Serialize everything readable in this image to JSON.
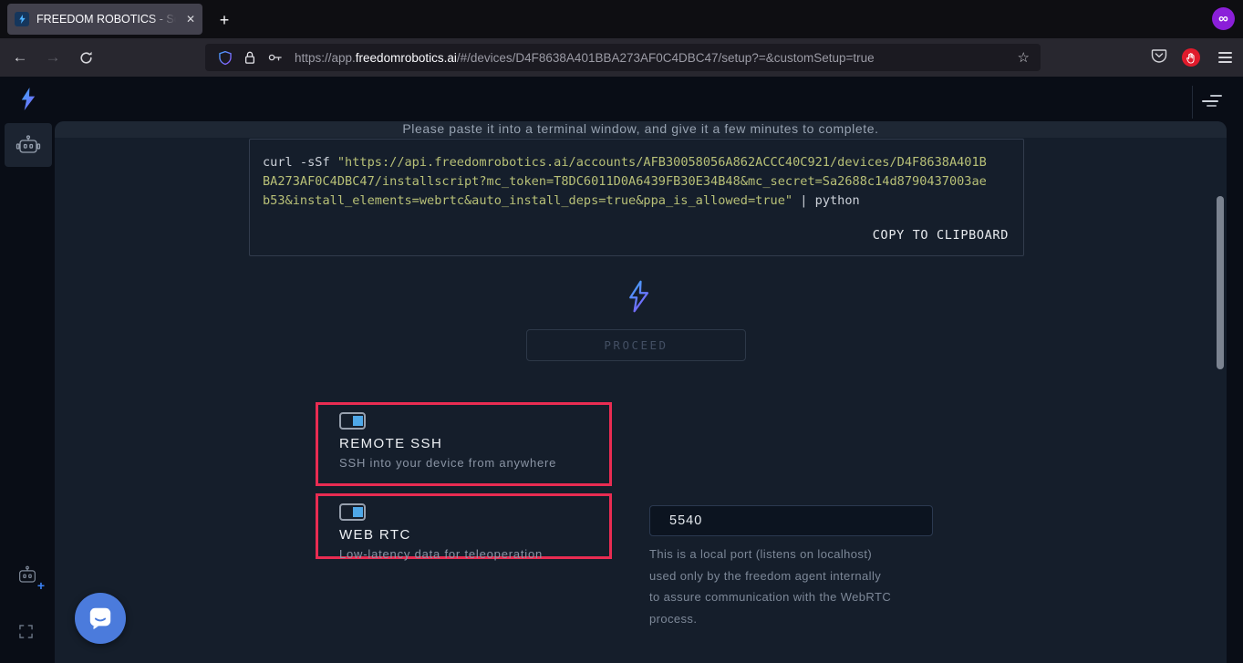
{
  "browser": {
    "tab": {
      "title": "FREEDOM ROBOTICS - Se",
      "close_glyph": "✕"
    },
    "new_tab_glyph": "+",
    "private_badge_glyph": "∞",
    "nav": {
      "back_glyph": "←",
      "forward_glyph": "→"
    },
    "url": {
      "prefix": "https://app.",
      "domain": "freedomrobotics.ai",
      "path": "/#/devices/D4F8638A401BBA273AF0C4DBC47/setup?=&customSetup=true"
    },
    "bookmark_star_glyph": "☆"
  },
  "sidebar": {
    "items": [
      "devices"
    ],
    "add_device_plus_glyph": "+"
  },
  "page": {
    "instruction_clipped": "Please paste it into a terminal window, and give it a few minutes to complete.",
    "code": {
      "lines": [
        [
          {
            "type": "plain",
            "text": "curl -sSf "
          },
          {
            "type": "string",
            "text": "\"https://api.freedomrobotics.ai/accounts/AFB30058056A862ACCC40C921/devices/D4F8638A401B"
          }
        ],
        [
          {
            "type": "string",
            "text": "BA273AF0C4DBC47/installscript?mc_token=T8DC6011D0A6439FB30E34B48&mc_secret=Sa2688c14d8790437003ae"
          }
        ],
        [
          {
            "type": "string",
            "text": "b53&install_elements=webrtc&auto_install_deps=true&ppa_is_allowed=true\""
          },
          {
            "type": "plain",
            "text": " | python"
          }
        ]
      ],
      "copy_label": "COPY TO CLIPBOARD"
    },
    "proceed_label": "PROCEED",
    "features": [
      {
        "title": "REMOTE SSH",
        "subtitle": "SSH into your device from anywhere",
        "checked": true
      },
      {
        "title": "WEB RTC",
        "subtitle": "Low-latency data for teleoperation",
        "checked": true
      }
    ],
    "port": {
      "value": "5540",
      "help_lines": [
        "This is a local port (listens on localhost)",
        "used only by the freedom agent internally",
        "to assure communication with the WebRTC",
        "process."
      ]
    }
  },
  "colors": {
    "accent_red": "#e92c52",
    "checkbox_blue": "#4fa8e8",
    "code_string": "#b8c077",
    "chat_blue": "#4b7bdc",
    "badge_purple": "#8b1fd9",
    "panel_bg": "#151e2b"
  }
}
